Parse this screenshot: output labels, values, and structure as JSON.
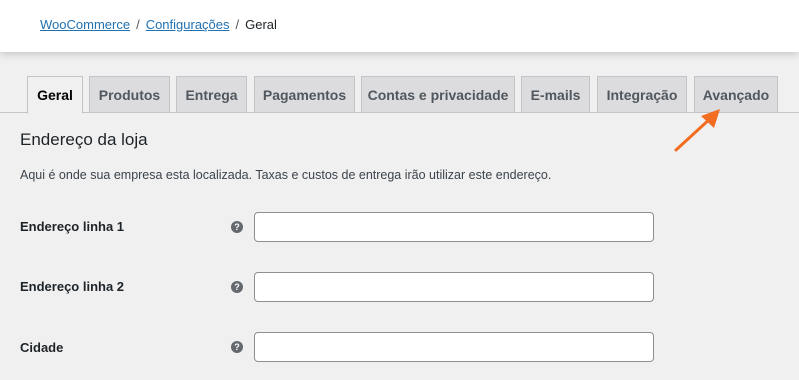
{
  "breadcrumb": {
    "items": [
      {
        "label": "WooCommerce",
        "link": true
      },
      {
        "label": "Configurações",
        "link": true
      },
      {
        "label": "Geral",
        "link": false
      }
    ],
    "separator": "/"
  },
  "tabs": [
    {
      "label": "Geral",
      "active": true
    },
    {
      "label": "Produtos"
    },
    {
      "label": "Entrega"
    },
    {
      "label": "Pagamentos"
    },
    {
      "label": "Contas e privacidade"
    },
    {
      "label": "E-mails"
    },
    {
      "label": "Integração"
    },
    {
      "label": "Avançado"
    }
  ],
  "section": {
    "title": "Endereço da loja",
    "description": "Aqui é onde sua empresa esta localizada. Taxas e custos de entrega irão utilizar este endereço."
  },
  "fields": [
    {
      "label": "Endereço linha 1",
      "help": "?",
      "value": "",
      "placeholder": ""
    },
    {
      "label": "Endereço linha 2",
      "help": "?",
      "value": "",
      "placeholder": ""
    },
    {
      "label": "Cidade",
      "help": "?",
      "value": "",
      "placeholder": ""
    }
  ],
  "colors": {
    "link": "#2271b1",
    "annotation_arrow": "#f26d21"
  },
  "icons": {
    "help": "question-circle-icon",
    "annotation": "arrow-annotation-icon"
  }
}
